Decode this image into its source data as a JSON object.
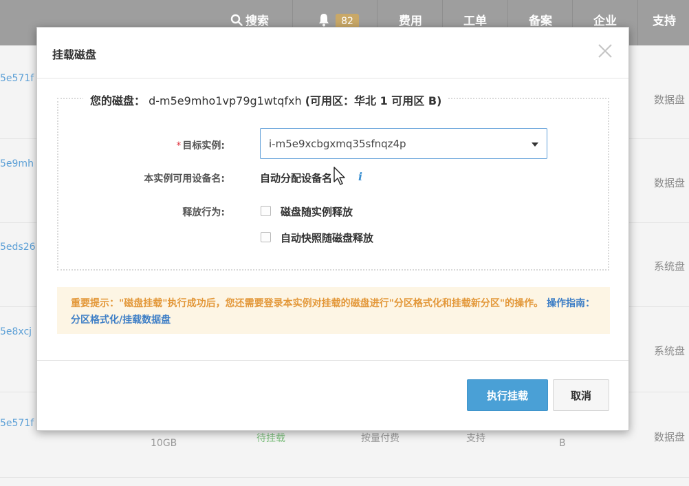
{
  "topnav": {
    "search_label": "搜索",
    "notification_count": "82",
    "items": [
      "费用",
      "工单",
      "备案",
      "企业",
      "支持"
    ]
  },
  "background_rows": [
    {
      "id_fragment": "5e571f",
      "type": "数据盘"
    },
    {
      "id_fragment": "5e9mh",
      "type": "数据盘"
    },
    {
      "id_fragment": "5eds26",
      "type": "系统盘"
    },
    {
      "id_fragment": "5e8xcj",
      "type": "系统盘"
    },
    {
      "id_fragment": "5e571f",
      "type": "数据盘",
      "size": "10GB",
      "status": "待挂载",
      "billing": "按量付费",
      "support": "支持",
      "extra": "B"
    }
  ],
  "modal": {
    "title": "挂载磁盘",
    "disk_prefix": "您的磁盘：",
    "disk_id": "d-m5e9mho1vp79g1wtqfxh",
    "zone_text": "(可用区：华北 1 可用区 B)",
    "target_label": "目标实例:",
    "target_value": "i-m5e9xcbgxmq35sfnqz4p",
    "device_label": "本实例可用设备名:",
    "device_value": "自动分配设备名",
    "release_label": "释放行为:",
    "checkbox_release_with_instance": "磁盘随实例释放",
    "checkbox_snapshot_release": "自动快照随磁盘释放",
    "notice_text": "重要提示：\"磁盘挂载\"执行成功后，您还需要登录本实例对挂载的磁盘进行\"分区格式化和挂载新分区\"的操作。",
    "guide_label": "操作指南：",
    "guide_link": "分区格式化/挂载数据盘",
    "confirm_button": "执行挂载",
    "cancel_button": "取消"
  },
  "colors": {
    "primary": "#4aa0d6",
    "link": "#3f7fc6",
    "warning_text": "#e3983a",
    "warning_bg": "#fdf5e4",
    "required": "#e0313c"
  }
}
